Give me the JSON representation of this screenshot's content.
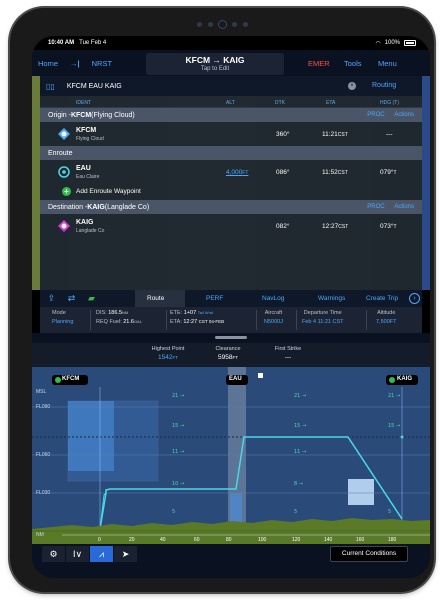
{
  "status": {
    "time": "10:40 AM",
    "date": "Tue Feb 4",
    "battery": "100%"
  },
  "topnav": {
    "home": "Home",
    "nrst": "NRST",
    "title": "KFCM → KAIG",
    "subtitle": "Tap to Edit",
    "emer": "EMER",
    "tools": "Tools",
    "menu": "Menu"
  },
  "fpl": {
    "route_text": "KFCM EAU KAIG",
    "routing": "Routing",
    "columns": {
      "ident": "IDENT",
      "alt": "ALT",
      "dtk": "DTK",
      "eta": "ETA",
      "hdg": "HDG (T)"
    },
    "origin": {
      "prefix": "Origin - ",
      "code": "KFCM",
      "name": " (Flying Cloud)",
      "proc": "PROC",
      "actions": "Actions",
      "ident": "KFCM",
      "sub": "Flying Cloud",
      "dtk": "360°",
      "eta": "11:21",
      "eta_tz": "CST",
      "hdg": "---"
    },
    "enroute": {
      "label": "Enroute",
      "ident": "EAU",
      "sub": "Eau Claire",
      "alt": "4,000",
      "alt_unit": "FT",
      "dtk": "086°",
      "eta": "11:52",
      "eta_tz": "CST",
      "hdg": "079°",
      "hdg_unit": "T",
      "add_label": "Add Enroute Waypoint"
    },
    "destination": {
      "prefix": "Destination - ",
      "code": "KAIG",
      "name": " (Langlade Co)",
      "proc": "PROC",
      "actions": "Actions",
      "ident": "KAIG",
      "sub": "Langlade Co",
      "dtk": "082°",
      "eta": "12:27",
      "eta_tz": "CST",
      "hdg": "073°",
      "hdg_unit": "T"
    }
  },
  "tabs": {
    "route": "Route",
    "perf": "PERF",
    "navlog": "NavLog",
    "warnings": "Warnings",
    "create_trip": "Create Trip"
  },
  "summary": {
    "mode_label": "Mode",
    "mode_value": "Planning",
    "dis_label": "DIS:",
    "dis_value": "186.5",
    "dis_unit": "NM",
    "req_label": "REQ Fuel:",
    "req_value": "21.6",
    "req_unit": "GAL",
    "ete_label": "ETE:",
    "ete_value": "1+07",
    "ete_tail": "Tail Wnd",
    "eta_label": "ETA:",
    "eta_value": "12:27",
    "eta_tail": "CST 04-FEB",
    "aircraft_label": "Aircraft",
    "aircraft_value": "N5000J",
    "departure_label": "Departure Time",
    "departure_value": "Feb 4  11:21 CST",
    "altitude_label": "Altitude",
    "altitude_value": "7,500FT"
  },
  "profile_header": {
    "highest_label": "Highest Point",
    "highest_value": "1542",
    "highest_unit": "FT",
    "clearance_label": "Clearance",
    "clearance_value": "5958",
    "clearance_unit": "FT",
    "first_strike_label": "First Strike",
    "first_strike_value": "---"
  },
  "profile": {
    "origin": "KFCM",
    "mid": "EAU",
    "destination": "KAIG",
    "msl": "MSL",
    "fl_labels": [
      "FL090",
      "FL060",
      "FL030",
      "2"
    ],
    "nm_label": "NM",
    "nm_ticks": [
      "0",
      "20",
      "40",
      "60",
      "80",
      "100",
      "120",
      "140",
      "160",
      "180"
    ],
    "time_ticks": [
      "0",
      "0",
      "160",
      "60",
      "60",
      "160",
      "0"
    ]
  },
  "bottom": {
    "current_conditions": "Current Conditions"
  }
}
